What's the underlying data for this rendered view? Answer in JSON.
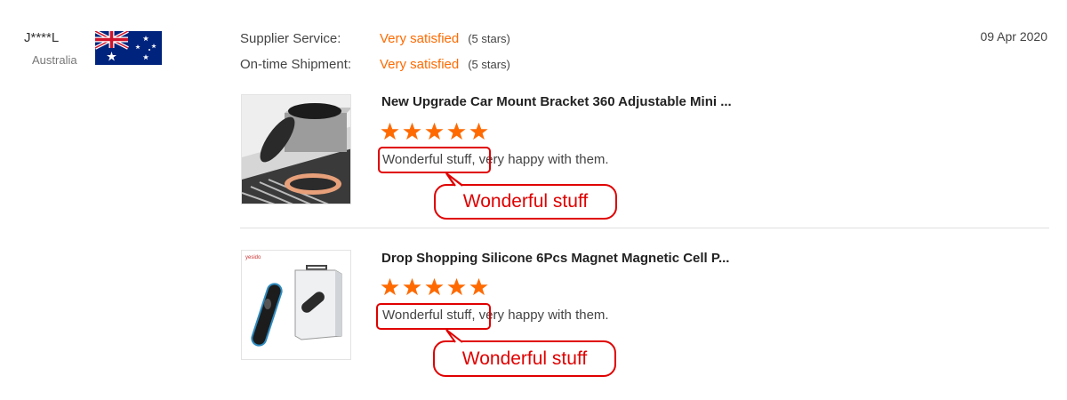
{
  "reviewer": {
    "name": "J****L",
    "country": "Australia",
    "flag_icon": "australia-flag-icon"
  },
  "date": "09 Apr 2020",
  "ratings": [
    {
      "label": "Supplier Service:",
      "value": "Very satisfied",
      "note": "(5 stars)"
    },
    {
      "label": "On-time Shipment:",
      "value": "Very satisfied",
      "note": "(5 stars)"
    }
  ],
  "products": [
    {
      "title": "New Upgrade Car Mount Bracket 360 Adjustable Mini ...",
      "stars": 5,
      "review_highlight": "Wonderful stuff,",
      "review_rest": " very happy with them.",
      "callout": "Wonderful stuff"
    },
    {
      "title": "Drop Shopping Silicone 6Pcs Magnet Magnetic Cell P...",
      "stars": 5,
      "review_highlight": "Wonderful stuff,",
      "review_rest": " very happy with them.",
      "callout": "Wonderful stuff"
    }
  ],
  "colors": {
    "accent": "#ff6a00",
    "annotation": "#e00000"
  }
}
